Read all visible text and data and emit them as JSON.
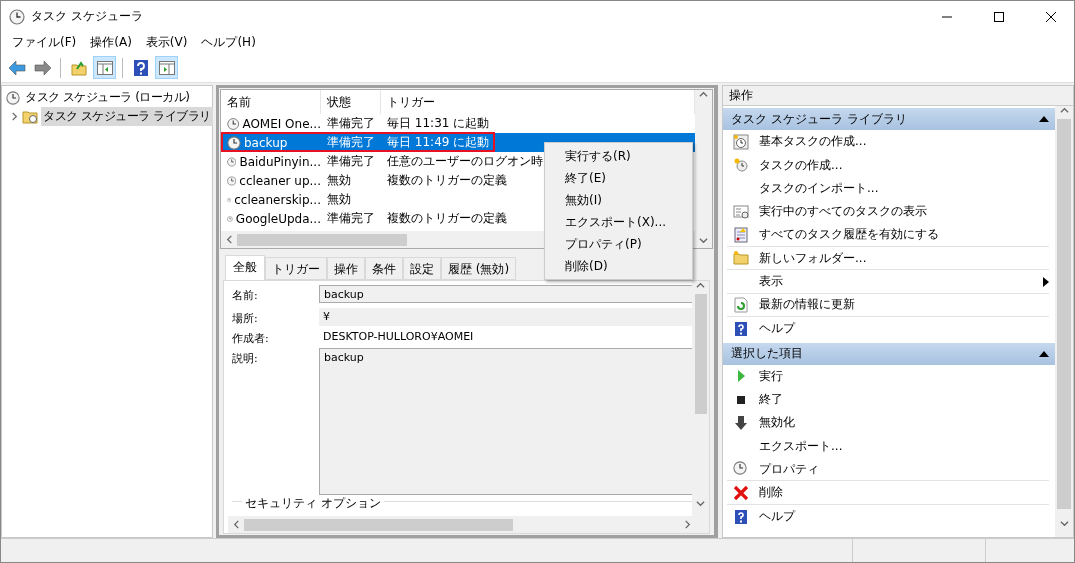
{
  "window": {
    "title": "タスク スケジューラ"
  },
  "menu": [
    "ファイル(F)",
    "操作(A)",
    "表示(V)",
    "ヘルプ(H)"
  ],
  "tree": [
    {
      "label": "タスク スケジューラ (ローカル)",
      "selected": false,
      "expanded": true,
      "children": [
        {
          "label": "タスク スケジューラ ライブラリ",
          "selected": true,
          "expanded": false
        }
      ]
    }
  ],
  "task_list": {
    "columns": [
      "名前",
      "状態",
      "トリガー"
    ],
    "rows": [
      {
        "name": "AOMEI One...",
        "status": "準備完了",
        "trigger": "毎日 11:31 に起動",
        "selected": false,
        "highlighted": false
      },
      {
        "name": "backup",
        "status": "準備完了",
        "trigger": "毎日 11:49 に起動",
        "selected": true,
        "highlighted": true
      },
      {
        "name": "BaiduPinyin...",
        "status": "準備完了",
        "trigger": "任意のユーザーのログオン時",
        "selected": false,
        "highlighted": false
      },
      {
        "name": "ccleaner up...",
        "status": "無効",
        "trigger": "複数のトリガーの定義",
        "selected": false,
        "highlighted": false
      },
      {
        "name": "ccleanerskip...",
        "status": "無効",
        "trigger": "",
        "selected": false,
        "highlighted": false
      },
      {
        "name": "GoogleUpda...",
        "status": "準備完了",
        "trigger": "複数のトリガーの定義",
        "selected": false,
        "highlighted": false
      }
    ]
  },
  "context_menu": [
    "実行する(R)",
    "終了(E)",
    "無効(I)",
    "エクスポート(X)...",
    "プロパティ(P)",
    "削除(D)"
  ],
  "detail_tabs": [
    {
      "label": "全般",
      "selected": true
    },
    {
      "label": "トリガー",
      "selected": false
    },
    {
      "label": "操作",
      "selected": false
    },
    {
      "label": "条件",
      "selected": false
    },
    {
      "label": "設定",
      "selected": false
    },
    {
      "label": "履歴 (無効)",
      "selected": false
    }
  ],
  "details": {
    "name_label": "名前:",
    "name_value": "backup",
    "location_label": "場所:",
    "location_value": "¥",
    "author_label": "作成者:",
    "author_value": "DESKTOP-HULLORO¥AOMEI",
    "description_label": "説明:",
    "description_value": "backup",
    "security_group": "セキュリティ オプション"
  },
  "actions": {
    "title": "操作",
    "sections": [
      {
        "title": "タスク スケジューラ ライブラリ",
        "expanded": true,
        "items": [
          {
            "kind": "basic-task",
            "label": "基本タスクの作成..."
          },
          {
            "kind": "create-task",
            "label": "タスクの作成..."
          },
          {
            "kind": "plain",
            "label": "タスクのインポート..."
          },
          {
            "kind": "running",
            "label": "実行中のすべてのタスクの表示"
          },
          {
            "kind": "history",
            "label": "すべてのタスク履歴を有効にする"
          },
          {
            "kind": "folder",
            "label": "新しいフォルダー..."
          },
          {
            "kind": "submenu",
            "label": "表示"
          },
          {
            "kind": "refresh",
            "label": "最新の情報に更新"
          },
          {
            "kind": "help",
            "label": "ヘルプ"
          }
        ]
      },
      {
        "title": "選択した項目",
        "expanded": true,
        "items": [
          {
            "kind": "run",
            "label": "実行"
          },
          {
            "kind": "stop",
            "label": "終了"
          },
          {
            "kind": "disable",
            "label": "無効化"
          },
          {
            "kind": "plain",
            "label": "エクスポート..."
          },
          {
            "kind": "properties",
            "label": "プロパティ"
          },
          {
            "kind": "delete",
            "label": "削除"
          },
          {
            "kind": "help",
            "label": "ヘルプ"
          }
        ]
      }
    ]
  }
}
